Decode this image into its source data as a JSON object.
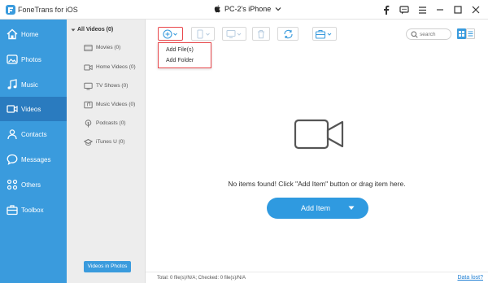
{
  "app": {
    "title": "FoneTrans for iOS",
    "device": "PC-2's iPhone"
  },
  "sidebar": {
    "items": [
      {
        "label": "Home",
        "icon": "home-icon"
      },
      {
        "label": "Photos",
        "icon": "photos-icon"
      },
      {
        "label": "Music",
        "icon": "music-icon"
      },
      {
        "label": "Videos",
        "icon": "video-icon",
        "active": true
      },
      {
        "label": "Contacts",
        "icon": "contacts-icon"
      },
      {
        "label": "Messages",
        "icon": "messages-icon"
      },
      {
        "label": "Others",
        "icon": "others-icon"
      },
      {
        "label": "Toolbox",
        "icon": "toolbox-icon"
      }
    ]
  },
  "categories": {
    "header": "All Videos (0)",
    "items": [
      {
        "label": "Movies (0)",
        "icon": "movie-icon"
      },
      {
        "label": "Home Videos (0)",
        "icon": "home-video-icon"
      },
      {
        "label": "TV Shows (0)",
        "icon": "tv-icon"
      },
      {
        "label": "Music Videos (0)",
        "icon": "music-video-icon"
      },
      {
        "label": "Podcasts (0)",
        "icon": "podcast-icon"
      },
      {
        "label": "iTunes U (0)",
        "icon": "itunes-u-icon"
      }
    ],
    "photos_button": "Videos in Photos"
  },
  "toolbar": {
    "search_placeholder": "search",
    "add_menu": [
      "Add File(s)",
      "Add Folder"
    ]
  },
  "main": {
    "empty_message": "No items found! Click \"Add Item\" button or drag item here.",
    "add_item_label": "Add Item"
  },
  "status": {
    "text": "Total: 0 file(s)/N/A; Checked: 0 file(s)/N/A",
    "data_lost": "Data lost?"
  },
  "colors": {
    "sidebar": "#3a9bdd",
    "sidebar_active": "#2a7bbf",
    "accent": "#2f9ae0",
    "highlight": "#e8474b"
  }
}
